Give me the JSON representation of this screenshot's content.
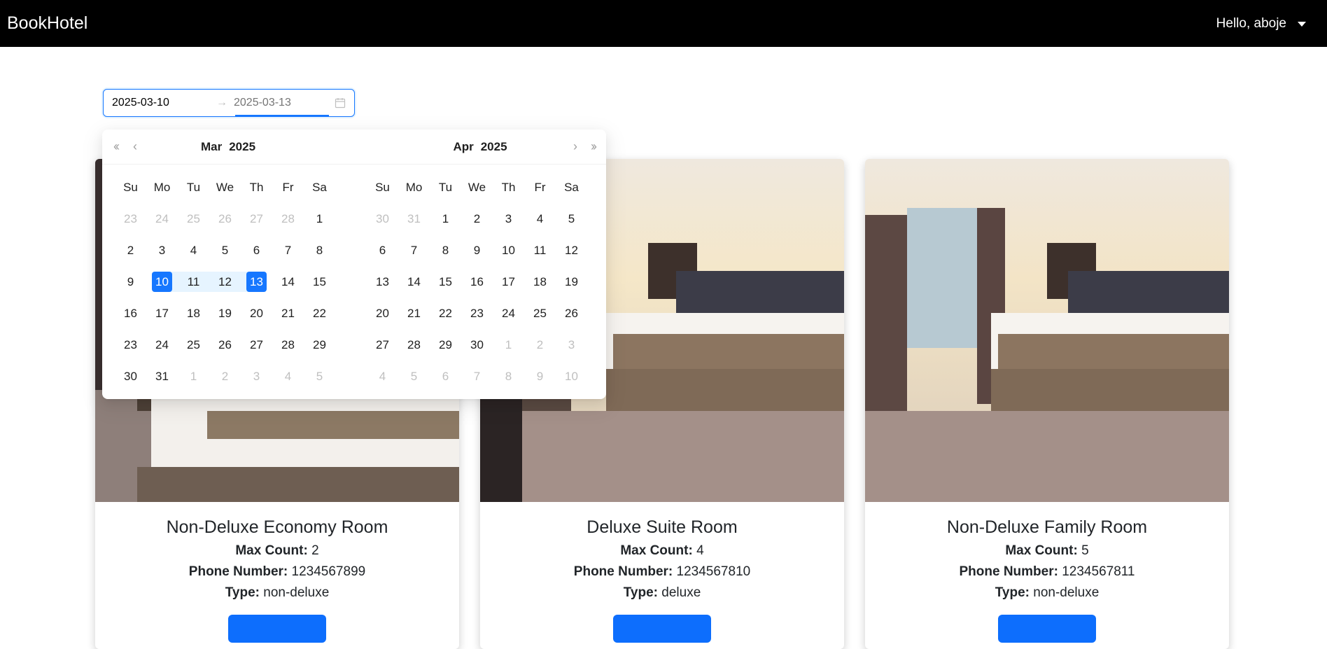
{
  "navbar": {
    "brand": "BookHotel",
    "user_greeting": "Hello, aboje"
  },
  "date_range": {
    "start_value": "2025-03-10",
    "end_placeholder": "2025-03-13",
    "separator": "→"
  },
  "calendar": {
    "weekdays": [
      "Su",
      "Mo",
      "Tu",
      "We",
      "Th",
      "Fr",
      "Sa"
    ],
    "left": {
      "month": "Mar",
      "year": "2025",
      "weeks": [
        [
          "23",
          "24",
          "25",
          "26",
          "27",
          "28",
          "1"
        ],
        [
          "2",
          "3",
          "4",
          "5",
          "6",
          "7",
          "8"
        ],
        [
          "9",
          "10",
          "11",
          "12",
          "13",
          "14",
          "15"
        ],
        [
          "16",
          "17",
          "18",
          "19",
          "20",
          "21",
          "22"
        ],
        [
          "23",
          "24",
          "25",
          "26",
          "27",
          "28",
          "29"
        ],
        [
          "30",
          "31",
          "1",
          "2",
          "3",
          "4",
          "5"
        ]
      ]
    },
    "right": {
      "month": "Apr",
      "year": "2025",
      "weeks": [
        [
          "30",
          "31",
          "1",
          "2",
          "3",
          "4",
          "5"
        ],
        [
          "6",
          "7",
          "8",
          "9",
          "10",
          "11",
          "12"
        ],
        [
          "13",
          "14",
          "15",
          "16",
          "17",
          "18",
          "19"
        ],
        [
          "20",
          "21",
          "22",
          "23",
          "24",
          "25",
          "26"
        ],
        [
          "27",
          "28",
          "29",
          "30",
          "1",
          "2",
          "3"
        ],
        [
          "4",
          "5",
          "6",
          "7",
          "8",
          "9",
          "10"
        ]
      ]
    }
  },
  "labels": {
    "max_count": "Max Count:",
    "phone": "Phone Number:",
    "type": "Type:"
  },
  "rooms": [
    {
      "title": "Non-Deluxe Economy Room",
      "max_count": "2",
      "phone": "1234567899",
      "type": "non-deluxe",
      "button": ""
    },
    {
      "title": "Deluxe Suite Room",
      "max_count": "4",
      "phone": "1234567810",
      "type": "deluxe",
      "button": ""
    },
    {
      "title": "Non-Deluxe Family Room",
      "max_count": "5",
      "phone": "1234567811",
      "type": "non-deluxe",
      "button": ""
    }
  ],
  "colors": {
    "navbar_bg": "#000000",
    "accent": "#1677ff",
    "range_bg": "#e6f4ff",
    "button": "#0d6efd"
  }
}
